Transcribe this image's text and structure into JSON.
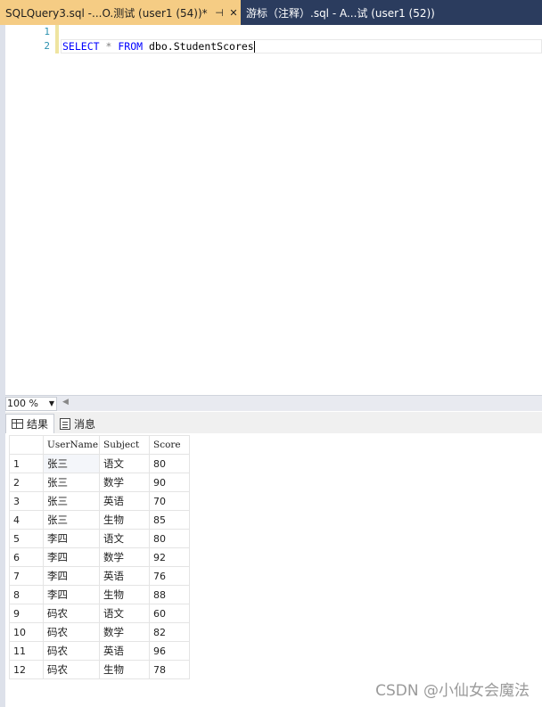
{
  "tabs": {
    "active": {
      "title": "SQLQuery3.sql -...O.测试 (user1 (54))*",
      "pin_icon": "pin-icon",
      "close_icon": "close-icon"
    },
    "inactive": {
      "title": "游标（注释）.sql - A...试 (user1 (52))"
    }
  },
  "editor": {
    "line_numbers": [
      "1",
      "2"
    ],
    "code": {
      "select": "SELECT",
      "star": "*",
      "from": "FROM",
      "schema": "dbo.",
      "table": "StudentScores"
    }
  },
  "zoom": {
    "value": "100 %"
  },
  "result_tabs": [
    {
      "label": "结果",
      "icon": "grid-icon"
    },
    {
      "label": "消息",
      "icon": "message-icon"
    }
  ],
  "results": {
    "columns": [
      "UserName",
      "Subject",
      "Score"
    ],
    "rows": [
      [
        "1",
        "张三",
        "语文",
        "80"
      ],
      [
        "2",
        "张三",
        "数学",
        "90"
      ],
      [
        "3",
        "张三",
        "英语",
        "70"
      ],
      [
        "4",
        "张三",
        "生物",
        "85"
      ],
      [
        "5",
        "李四",
        "语文",
        "80"
      ],
      [
        "6",
        "李四",
        "数学",
        "92"
      ],
      [
        "7",
        "李四",
        "英语",
        "76"
      ],
      [
        "8",
        "李四",
        "生物",
        "88"
      ],
      [
        "9",
        "码农",
        "语文",
        "60"
      ],
      [
        "10",
        "码农",
        "数学",
        "82"
      ],
      [
        "11",
        "码农",
        "英语",
        "96"
      ],
      [
        "12",
        "码农",
        "生物",
        "78"
      ]
    ]
  },
  "watermark": "CSDN @小仙女会魔法",
  "colors": {
    "tab_active": "#f5cc84",
    "tab_strip": "#2b3c5e",
    "keyword": "#0000ff"
  }
}
